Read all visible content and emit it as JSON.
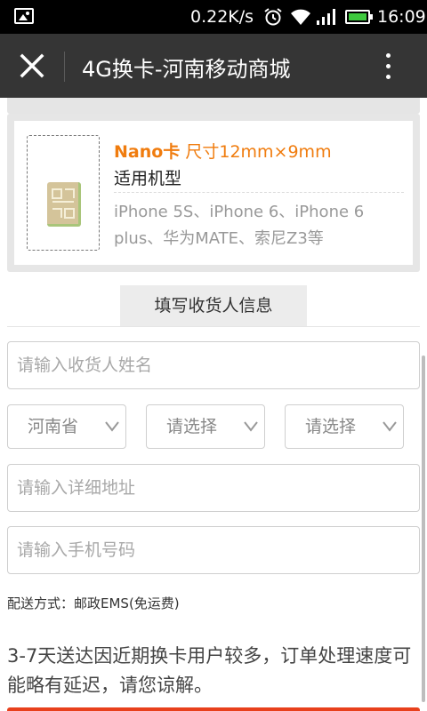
{
  "status_bar": {
    "speed": "0.22K/s",
    "time": "16:09",
    "icons": [
      "image-icon",
      "alarm-icon",
      "wifi-icon",
      "signal-icon",
      "battery-icon"
    ]
  },
  "toolbar": {
    "title": "4G换卡-河南移动商城",
    "close_icon": "close-icon",
    "more_icon": "more-vertical-icon"
  },
  "sim_card": {
    "name": "Nano卡",
    "size": "尺寸12mm×9mm",
    "models_label": "适用机型",
    "models": "iPhone 5S、iPhone 6、iPhone 6 plus、华为MATE、索尼Z3等"
  },
  "section": {
    "title": "填写收货人信息"
  },
  "form": {
    "name_placeholder": "请输入收货人姓名",
    "province_value": "河南省",
    "city_value": "请选择",
    "district_value": "请选择",
    "address_placeholder": "请输入详细地址",
    "phone_placeholder": "请输入手机号码"
  },
  "delivery": "配送方式：邮政EMS(免运费)",
  "notice": "3-7天送达因近期换卡用户较多，订单处理速度可能略有延迟，请您谅解。",
  "colors": {
    "accent": "#f07c0e",
    "toolbar": "#353535",
    "bottom_button": "#e8401c"
  }
}
